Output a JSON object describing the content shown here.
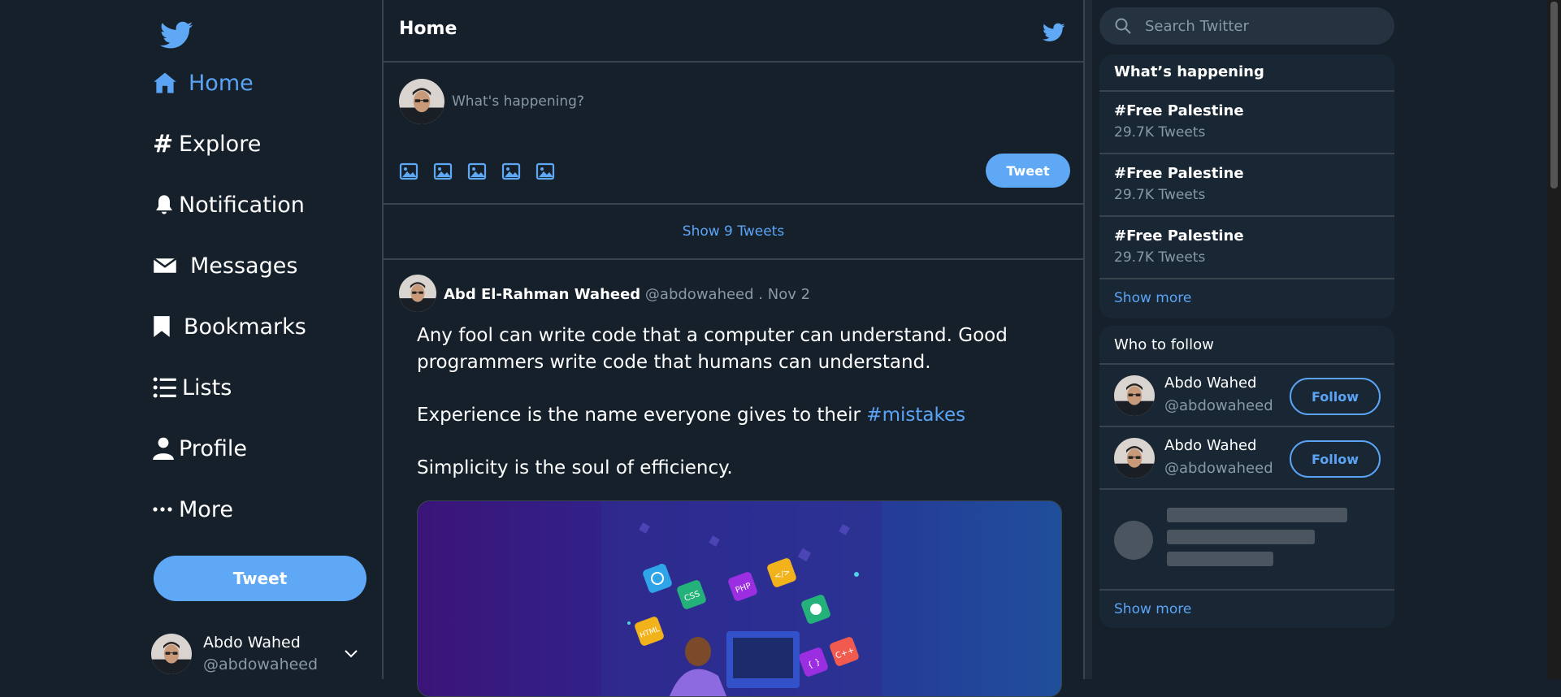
{
  "sidebar": {
    "logo_icon": "twitter-bird-icon",
    "nav": [
      {
        "label": "Home",
        "icon": "home-icon",
        "active": true
      },
      {
        "label": "Explore",
        "icon": "hashtag-icon"
      },
      {
        "label": "Notification",
        "icon": "bell-icon"
      },
      {
        "label": "Messages",
        "icon": "envelope-icon"
      },
      {
        "label": "Bookmarks",
        "icon": "bookmark-icon"
      },
      {
        "label": "Lists",
        "icon": "list-icon"
      },
      {
        "label": "Profile",
        "icon": "user-icon"
      },
      {
        "label": "More",
        "icon": "more-dots-icon"
      }
    ],
    "tweet_button": "Tweet",
    "account": {
      "name": "Abdo Wahed",
      "handle": "@abdowaheed"
    }
  },
  "main": {
    "title": "Home",
    "compose": {
      "placeholder": "What's happening?",
      "tweet_button": "Tweet"
    },
    "show_new": "Show 9 Tweets",
    "post": {
      "author": "Abd El-Rahman Waheed",
      "handle": "@abdowaheed",
      "date": ". Nov 2",
      "text1": "Any fool can write code that a computer can understand. Good programmers write code that humans can understand.",
      "text2": "Experience is the name everyone gives to their",
      "hashtag": "#mistakes",
      "text3": "Simplicity is the soul of efficiency.",
      "image_labels": [
        "CSS",
        "PHP",
        "</>",
        "HTML",
        "C++",
        "{ }"
      ]
    }
  },
  "right": {
    "search_placeholder": "Search Twitter",
    "trends": {
      "title": "What’s happening",
      "items": [
        {
          "name": "#Free Palestine",
          "count": "29.7K Tweets"
        },
        {
          "name": "#Free Palestine",
          "count": "29.7K Tweets"
        },
        {
          "name": "#Free Palestine",
          "count": "29.7K Tweets"
        }
      ],
      "show_more": "Show more"
    },
    "who_to_follow": {
      "title": "Who to follow",
      "items": [
        {
          "name": "Abdo Wahed",
          "handle": "@abdowaheed",
          "button": "Follow"
        },
        {
          "name": "Abdo Wahed",
          "handle": "@abdowaheed",
          "button": "Follow"
        }
      ],
      "show_more": "Show more"
    }
  },
  "colors": {
    "background": "#15202b",
    "panel": "#192734",
    "accent": "#5ea8f5",
    "border": "#38444d",
    "muted": "#8899a6"
  }
}
